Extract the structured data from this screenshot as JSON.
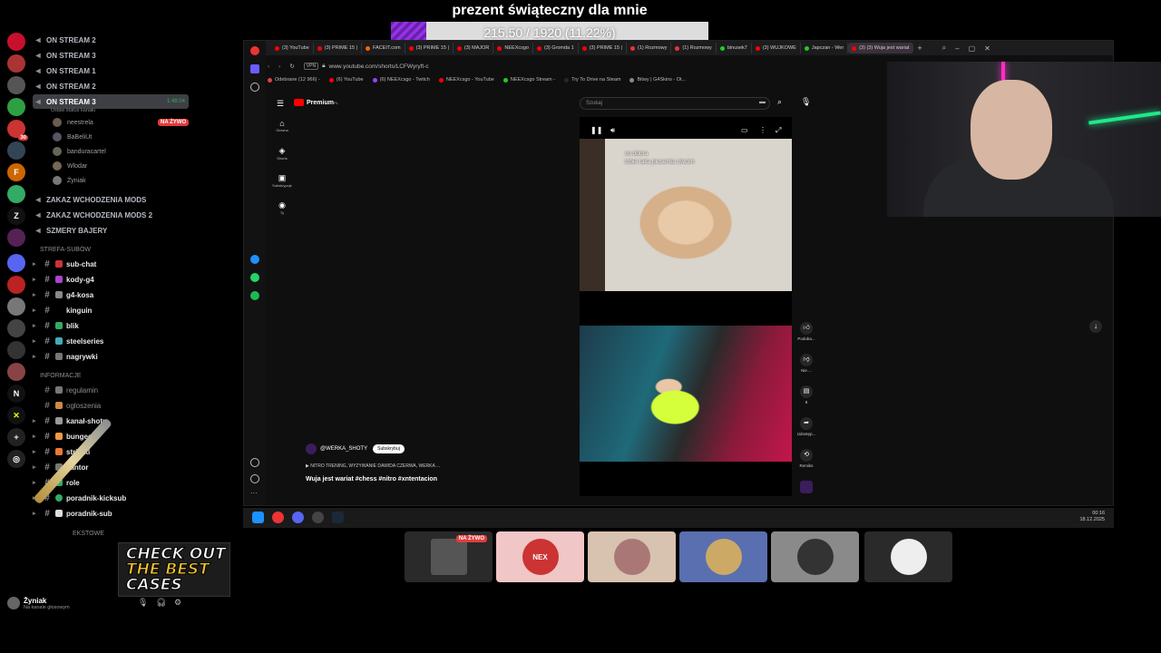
{
  "banner": {
    "title": "prezent świąteczny dla mnie",
    "progress_text": "215.50 / 1920 (11.22%)",
    "progress_fraction": 0.1122,
    "fill_color": "#8b2fd6"
  },
  "discord": {
    "channels": [
      {
        "label": "ON STREAM 2",
        "kind": "voice"
      },
      {
        "label": "ON STREAM 3",
        "kind": "voice"
      },
      {
        "label": "ON STREAM 1",
        "kind": "voice"
      },
      {
        "label": "ON STREAM 2",
        "kind": "voice"
      },
      {
        "label": "ON STREAM 3",
        "kind": "voice-active",
        "time": "1:48:04",
        "status": "Ustaw status kanału"
      }
    ],
    "voice_users": [
      "neestrela",
      "BaBeliUt",
      "banduracartel",
      "Wlodar",
      "Żyniak"
    ],
    "live_label": "NA ŻYWO",
    "more_voice": [
      "ZAKAZ WCHODZENIA MODS",
      "ZAKAZ WCHODZENIA MODS 2",
      "SZMERY BAJERY"
    ],
    "category_subs": "STREFA-SUBÓW",
    "sub_channels": [
      "sub-chat",
      "kody-g4",
      "g4-kosa",
      "kinguin",
      "blik",
      "steelseries",
      "nagrywki"
    ],
    "category_info": "INFORMACJE",
    "info_channels": [
      "regulamin",
      "ogloszenia"
    ],
    "info_channels_bold": [
      "kanał-shoty",
      "bungee",
      "strimki",
      "kantor",
      "role",
      "poradnik-kicksub",
      "poradnik-sub"
    ],
    "category_extra": "EKSTOWE",
    "user": {
      "name": "Żyniak",
      "status": "Na kanale głosowym"
    }
  },
  "browser": {
    "tabs": [
      "(3) YouTube",
      "(3) PRIME 15 |",
      "FACEIT.com",
      "(3) PRIME 15 |",
      "(3) MAJOR",
      "NEEXcsgo",
      "(3) Gromda 1",
      "(3) PRIME 15 |",
      "(1) Rozmowy",
      "(1) Rozmowy",
      "binusek7",
      "(3) WUJKOWE",
      "Japczan - Wer",
      "(3) (3) Wuja jest wariat"
    ],
    "url": "www.youtube.com/shorts/LCFWyryft-c",
    "vpn": "VPN",
    "bookmarks": [
      "Odebrane (12 966) -",
      "(6) YouTube",
      "(6) NEEXcsgo - Twitch",
      "NEEXcsgo - YouTube",
      "NEEXcsgo Stream -",
      "Try To Drive na Steam",
      "Bitwy | G4Skins - Ot..."
    ]
  },
  "youtube": {
    "logo": "Premium",
    "logo_sup": "PL",
    "search_placeholder": "Szukaj",
    "nav": [
      "Główna",
      "Shorts",
      "Subskrypcje",
      "Ty"
    ],
    "caption_line1": "co dobra",
    "caption_line2": "tobie taka piosenka dwóch",
    "actions": [
      {
        "label": "Podoba...",
        "icon": "like-icon"
      },
      {
        "label": "Nie ...",
        "icon": "dislike-icon"
      },
      {
        "label": "8",
        "icon": "comment-icon"
      },
      {
        "label": "Udostęp...",
        "icon": "share-icon"
      },
      {
        "label": "Remiks",
        "icon": "remix-icon"
      }
    ],
    "channel": "@WERKA_SHOTY",
    "subscribe": "Subskrybuj",
    "description": "▶ NITRO TRENING, WYZYWANIE DAWIDA CZERWA, WERKA ...",
    "title": "Wuja jest wariat #chess #nitro #xntentacion"
  },
  "taskbar": {
    "time": "00:16",
    "date": "18.12.2025"
  },
  "voice_tiles": [
    {
      "label": "",
      "live": "NA ŻYWO",
      "color": "#2a2a2a"
    },
    {
      "label": "NEX",
      "color": "#f0c6c6"
    },
    {
      "label": "",
      "color": "#d8c2b0"
    },
    {
      "label": "",
      "color": "#5a6fb0"
    },
    {
      "label": "",
      "color": "#8a8a8a"
    },
    {
      "label": "",
      "color": "#2a2a2a"
    }
  ],
  "promo": {
    "line1": "CHECK OUT",
    "line2": "THE BEST",
    "line3": "CASES"
  }
}
